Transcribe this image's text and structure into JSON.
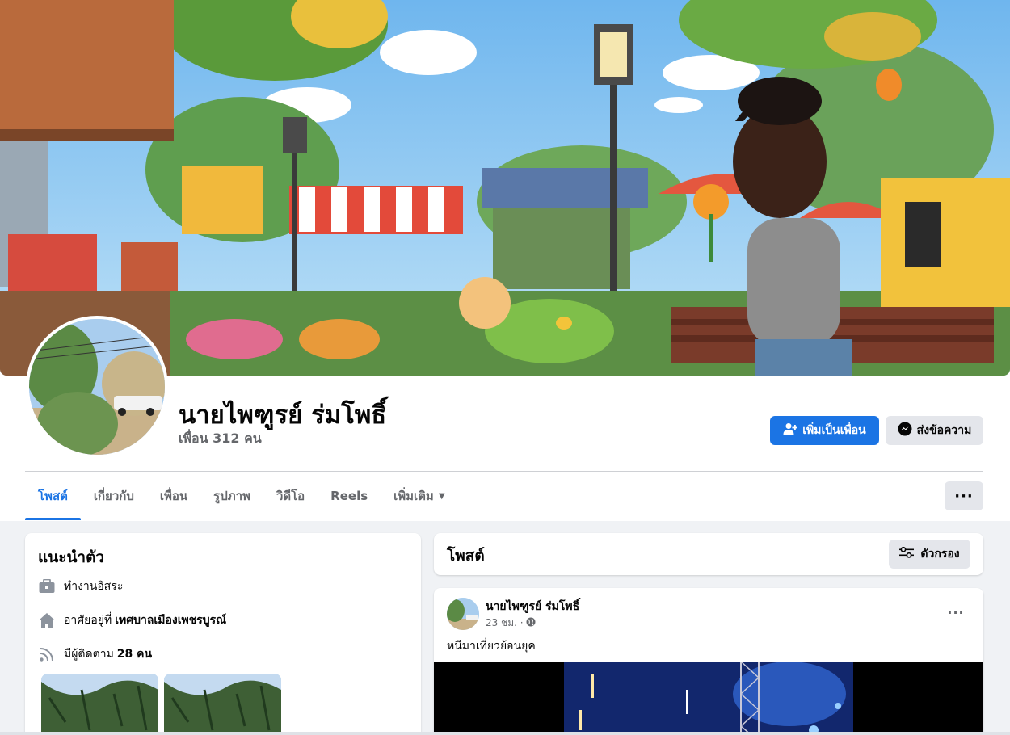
{
  "profile": {
    "name": "นายไพฑูรย์ ร่มโพธิ์",
    "friends": "เพื่อน 312 คน"
  },
  "actions": {
    "add_friend": "เพิ่มเป็นเพื่อน",
    "message": "ส่งข้อความ",
    "more": "···"
  },
  "tabs": [
    {
      "label": "โพสต์",
      "active": true
    },
    {
      "label": "เกี่ยวกับ"
    },
    {
      "label": "เพื่อน"
    },
    {
      "label": "รูปภาพ"
    },
    {
      "label": "วิดีโอ"
    },
    {
      "label": "Reels"
    },
    {
      "label": "เพิ่มเติม"
    }
  ],
  "intro": {
    "title": "แนะนำตัว",
    "work": "ทำงานอิสระ",
    "lives_prefix": "อาศัยอยู่ที่",
    "lives_place": "เทศบาลเมืองเพชรบูรณ์",
    "followers_prefix": "มีผู้ติดตาม",
    "followers_count": "28 คน"
  },
  "posts_section": {
    "title": "โพสต์",
    "filter": "ตัวกรอง"
  },
  "post": {
    "author": "นายไพฑูรย์ ร่มโพธิ์",
    "time": "23 ชม. ·",
    "text": "หนีมาเที่ยวย้อนยุค",
    "more": "···"
  },
  "icons": {
    "add_friend": "add-person-icon",
    "message": "messenger-icon",
    "work": "briefcase-icon",
    "home": "home-icon",
    "followers": "rss-icon",
    "filter": "sliders-icon",
    "privacy": "globe-icon"
  },
  "colors": {
    "accent": "#1b74e4",
    "secondary_button": "#e4e6eb",
    "page_background": "#f0f2f5",
    "muted_text": "#65676b"
  }
}
